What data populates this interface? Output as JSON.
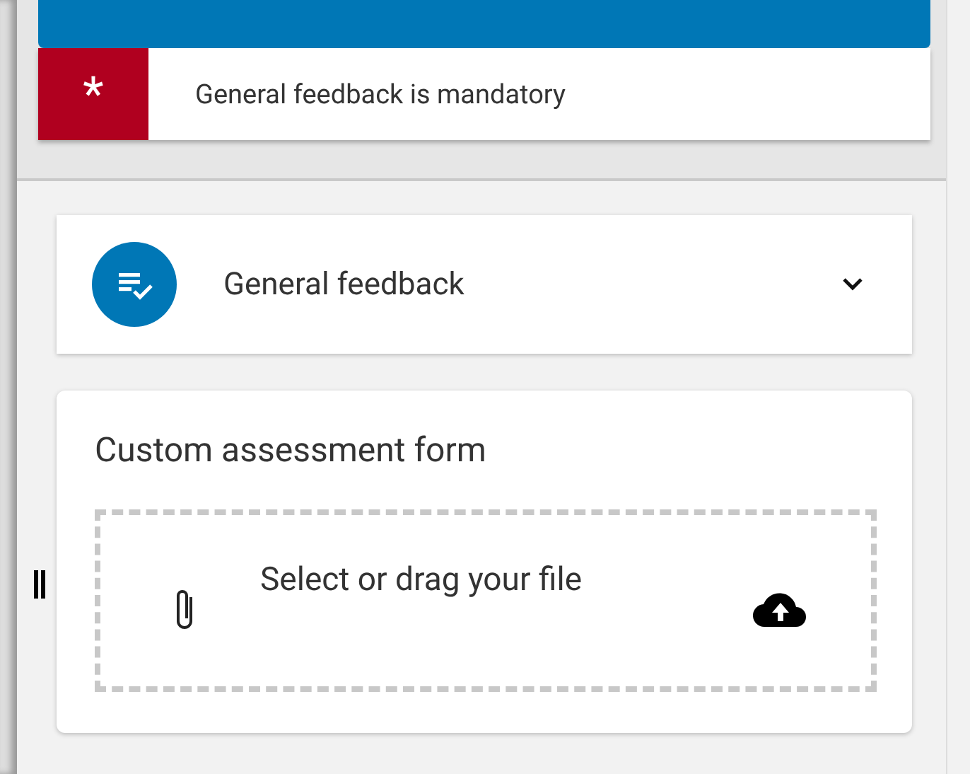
{
  "alert": {
    "marker": "*",
    "message": "General feedback is mandatory"
  },
  "feedback_panel": {
    "title": "General feedback",
    "expanded": false
  },
  "assessment_form": {
    "title": "Custom assessment form",
    "upload": {
      "placeholder": "Select or drag your file"
    }
  }
}
